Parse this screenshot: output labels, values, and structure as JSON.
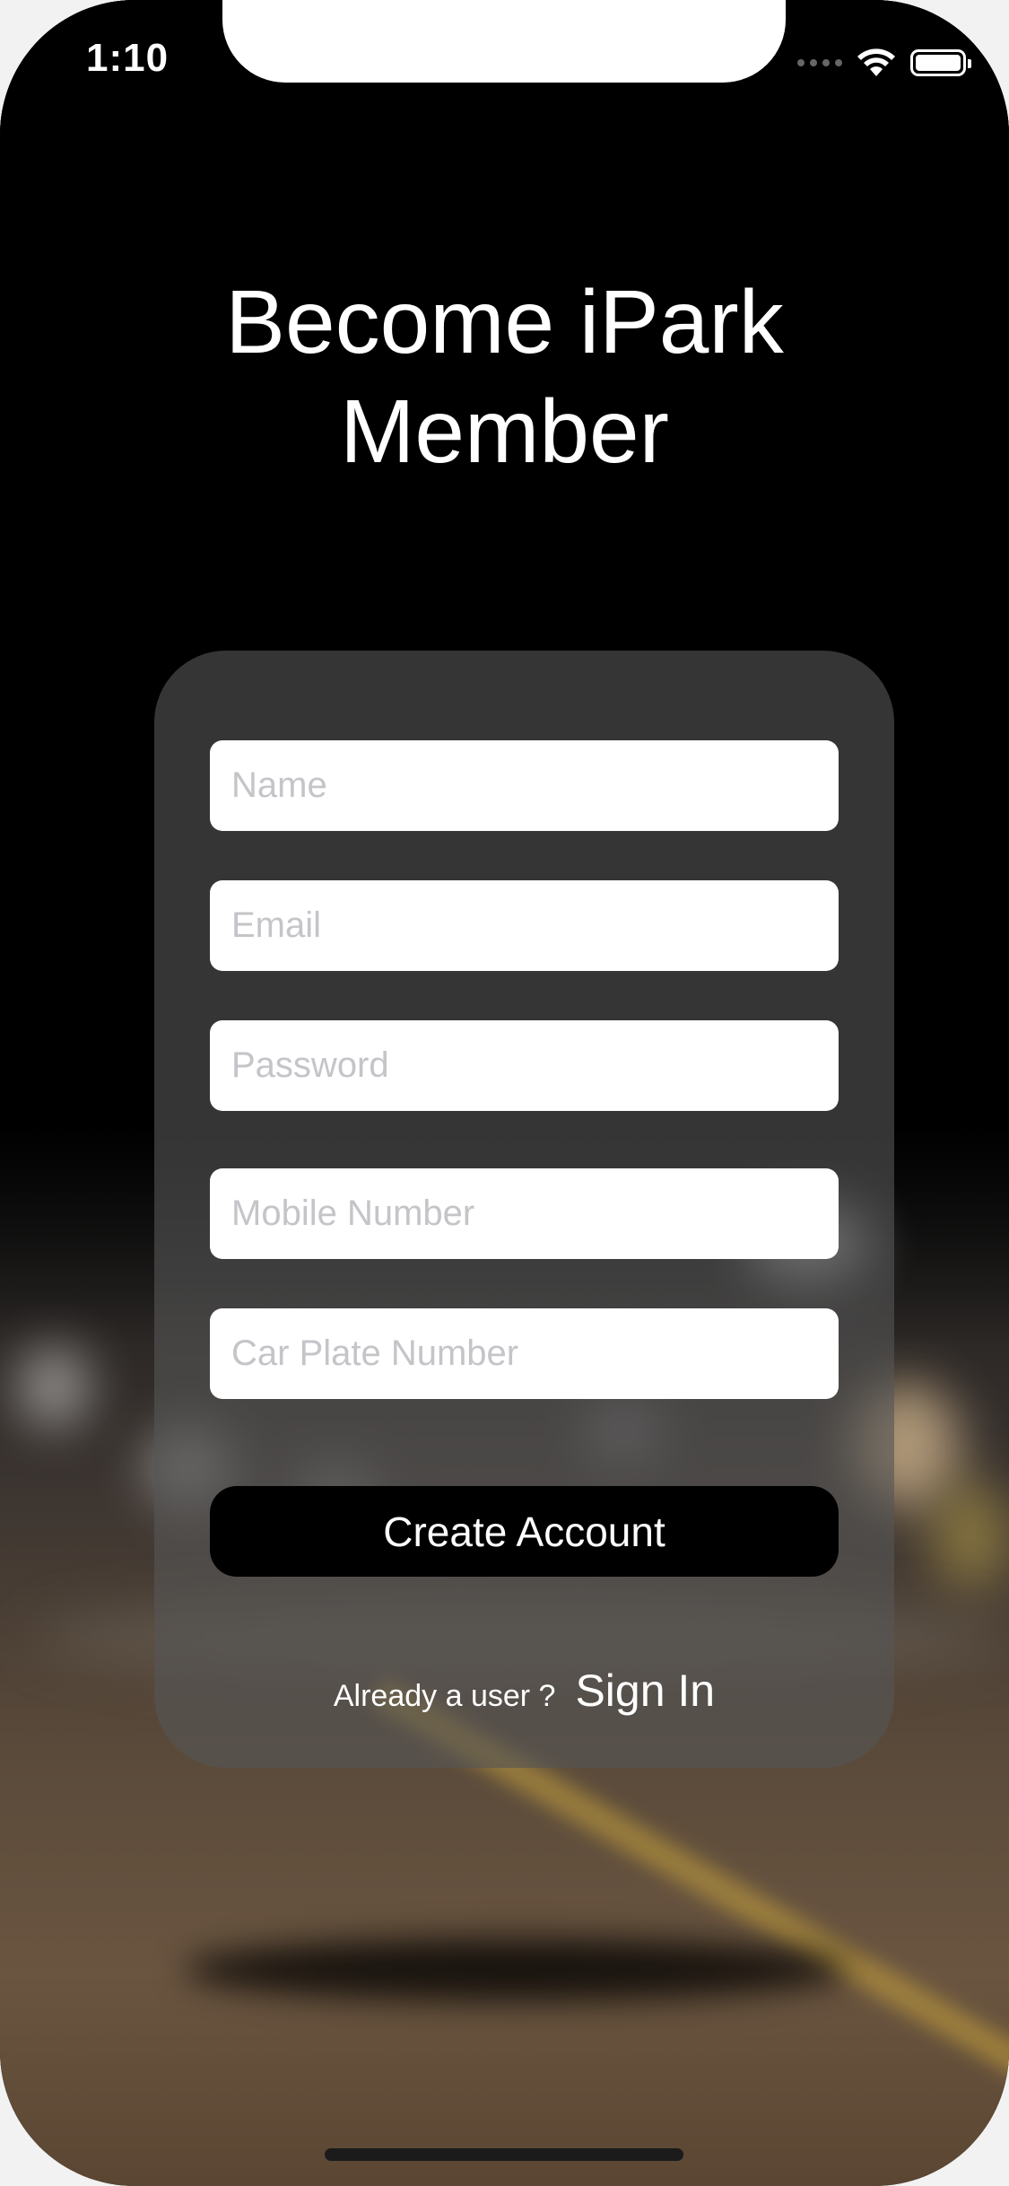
{
  "status_bar": {
    "time": "1:10",
    "icons": [
      "cellular-signal-icon",
      "wifi-icon",
      "battery-icon"
    ]
  },
  "title": {
    "line1": "Become iPark",
    "line2": "Member"
  },
  "form": {
    "name_placeholder": "Name",
    "email_placeholder": "Email",
    "password_placeholder": "Password",
    "mobile_placeholder": "Mobile Number",
    "plate_placeholder": "Car Plate Number",
    "name_value": "",
    "email_value": "",
    "password_value": "",
    "mobile_value": "",
    "plate_value": "",
    "create_button_label": "Create Account",
    "signin_prompt": "Already a user ?",
    "signin_link_label": "Sign In"
  },
  "colors": {
    "background": "#000000",
    "card": "#555555",
    "field_background": "#ffffff",
    "placeholder": "#c4c4c9",
    "button": "#000000",
    "text": "#ffffff"
  }
}
